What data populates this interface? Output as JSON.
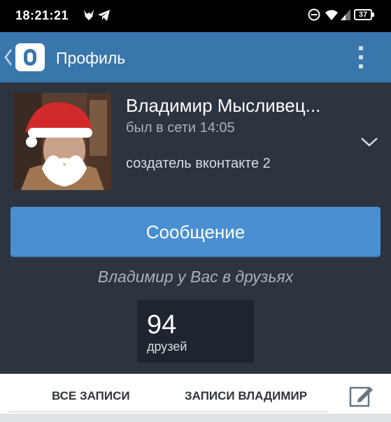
{
  "status_bar": {
    "time": "18:21:21",
    "battery": "37",
    "icons": [
      "animal-notification-icon",
      "telegram-icon",
      "do-not-disturb-icon",
      "wifi-icon",
      "signal-icon",
      "battery-icon"
    ]
  },
  "app_bar": {
    "title": "Профиль",
    "back_icon": "chevron-left-icon",
    "logo_icon": "app-logo-icon",
    "menu_icon": "overflow-menu-icon",
    "color": "#3976ab"
  },
  "profile": {
    "name": "Владимир Мысливец...",
    "status": "был в сети 14:05",
    "description": "создатель вконтакте 2",
    "expand_icon": "chevron-down-icon"
  },
  "actions": {
    "message_label": "Сообщение",
    "button_color": "#4a8fd1"
  },
  "friend_note": "Владимир у Вас в друзьях",
  "friends": {
    "count": "94",
    "label": "друзей"
  },
  "tabs": {
    "items": [
      {
        "label": "ВСЕ ЗАПИСИ"
      },
      {
        "label": "ЗАПИСИ ВЛАДИМИР"
      }
    ],
    "edit_icon": "edit-icon"
  },
  "colors": {
    "background": "#2c3440",
    "friends_box": "#1e252e"
  }
}
